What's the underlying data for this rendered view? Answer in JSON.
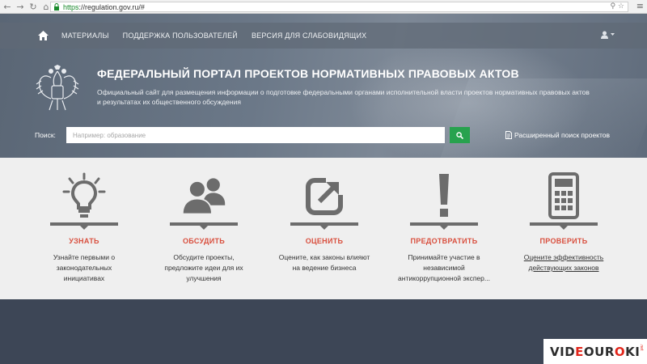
{
  "browser": {
    "url_scheme": "https",
    "url_rest": "://regulation.gov.ru/#",
    "back_icon": "arrow-left-icon",
    "forward_icon": "arrow-right-icon",
    "reload_icon": "reload-icon",
    "home_icon": "home-icon"
  },
  "topnav": {
    "items": [
      "МАТЕРИАЛЫ",
      "ПОДДЕРЖКА ПОЛЬЗОВАТЕЛЕЙ",
      "ВЕРСИЯ ДЛЯ СЛАБОВИДЯЩИХ"
    ]
  },
  "hero": {
    "title": "ФЕДЕРАЛЬНЫЙ ПОРТАЛ ПРОЕКТОВ НОРМАТИВНЫХ ПРАВОВЫХ АКТОВ",
    "description": "Официальный сайт для размещения информации о подготовке федеральными органами исполнительной власти проектов нормативных правовых актов и результатах их общественного обсуждения"
  },
  "search": {
    "label": "Поиск:",
    "placeholder": "Например: образование",
    "value": "",
    "advanced_label": "Расширенный поиск проектов"
  },
  "features": [
    {
      "icon": "lightbulb-icon",
      "title": "УЗНАТЬ",
      "text": "Узнайте первыми о законодательных инициативах"
    },
    {
      "icon": "users-icon",
      "title": "ОБСУДИТЬ",
      "text": "Обсудите проекты, предложите идеи для их улучшения"
    },
    {
      "icon": "external-link-icon",
      "title": "ОЦЕНИТЬ",
      "text": "Оцените, как законы влияют на ведение бизнеса"
    },
    {
      "icon": "exclamation-icon",
      "title": "ПРЕДОТВРАТИТЬ",
      "text": "Принимайте участие в независимой антикоррупционной экспер..."
    },
    {
      "icon": "calculator-icon",
      "title": "ПРОВЕРИТЬ",
      "text": "Оцените эффективность действующих законов"
    }
  ],
  "watermark": {
    "text": "VIDEOUROKI",
    "suffix": ".net"
  },
  "colors": {
    "accent_red": "#d9503f",
    "search_green": "#27a24e",
    "footer": "#3d4656"
  }
}
